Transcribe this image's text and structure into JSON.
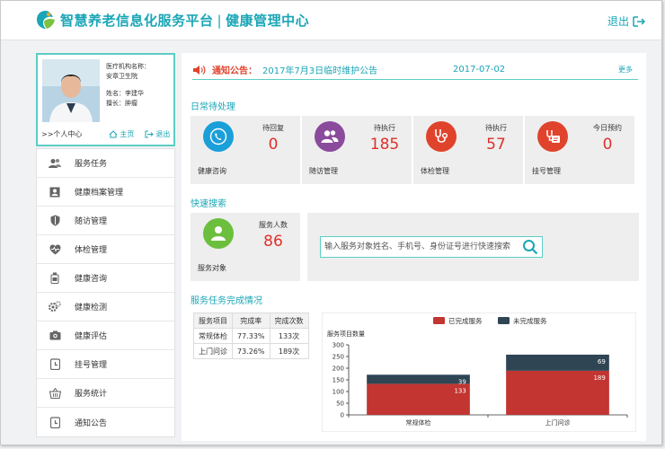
{
  "header": {
    "title": "智慧养老信息化服务平台",
    "subtitle": "健康管理中心",
    "logout": "退出"
  },
  "profile": {
    "org_label": "医疗机构名称：",
    "org_name": "安章卫生院",
    "name_label": "姓名：李建华",
    "position_label": "擅长：肿瘤",
    "personal_center": ">>个人中心",
    "home": "主页",
    "exit": "退出"
  },
  "menu": {
    "items": [
      {
        "label": "服务任务",
        "icon": "users-icon"
      },
      {
        "label": "健康档案管理",
        "icon": "profile-card-icon"
      },
      {
        "label": "随访管理",
        "icon": "shield-icon"
      },
      {
        "label": "体检管理",
        "icon": "heart-pulse-icon"
      },
      {
        "label": "健康咨询",
        "icon": "bottle-icon"
      },
      {
        "label": "健康检测",
        "icon": "gear-icon"
      },
      {
        "label": "健康评估",
        "icon": "camera-icon"
      },
      {
        "label": "挂号管理",
        "icon": "clock-icon"
      },
      {
        "label": "服务统计",
        "icon": "basket-icon"
      },
      {
        "label": "通知公告",
        "icon": "clock-icon"
      }
    ]
  },
  "notice": {
    "label": "通知公告：",
    "text": "2017年7月3日临时维护公告",
    "date": "2017-07-02",
    "more": "更多"
  },
  "daily": {
    "title": "日常待处理",
    "cards": [
      {
        "label": "健康咨询",
        "status": "待回复",
        "count": "0",
        "color": "#1a9fd9",
        "icon": "phone-icon"
      },
      {
        "label": "随访管理",
        "status": "待执行",
        "count": "185",
        "color": "#8a4b9c",
        "icon": "users-icon"
      },
      {
        "label": "体检管理",
        "status": "待执行",
        "count": "57",
        "color": "#e0432c",
        "icon": "stethoscope-icon"
      },
      {
        "label": "挂号管理",
        "status": "今日预约",
        "count": "0",
        "color": "#e0432c",
        "icon": "register-icon"
      }
    ]
  },
  "quick_search": {
    "title": "快速搜索",
    "card_label": "服务对象",
    "card_status": "服务人数",
    "card_count": "86",
    "card_color": "#6cbf3d",
    "placeholder": "输入服务对象姓名、手机号、身份证号进行快速搜索"
  },
  "completion": {
    "title": "服务任务完成情况",
    "headers": [
      "服务项目",
      "完成率",
      "完成次数"
    ],
    "rows": [
      [
        "常规体检",
        "77.33%",
        "133次"
      ],
      [
        "上门问诊",
        "73.26%",
        "189次"
      ]
    ]
  },
  "chart_data": {
    "type": "bar",
    "stacked": true,
    "ylabel": "服务项目数量",
    "categories": [
      "常规体检",
      "上门问诊"
    ],
    "series": [
      {
        "name": "已完成服务",
        "values": [
          133,
          189
        ],
        "color": "#c23531"
      },
      {
        "name": "未完成服务",
        "values": [
          39,
          69
        ],
        "color": "#2f4554"
      }
    ],
    "ylim": [
      0,
      300
    ],
    "yticks": [
      0,
      50,
      100,
      150,
      200,
      250,
      300
    ],
    "legend": "top",
    "grid": false
  }
}
